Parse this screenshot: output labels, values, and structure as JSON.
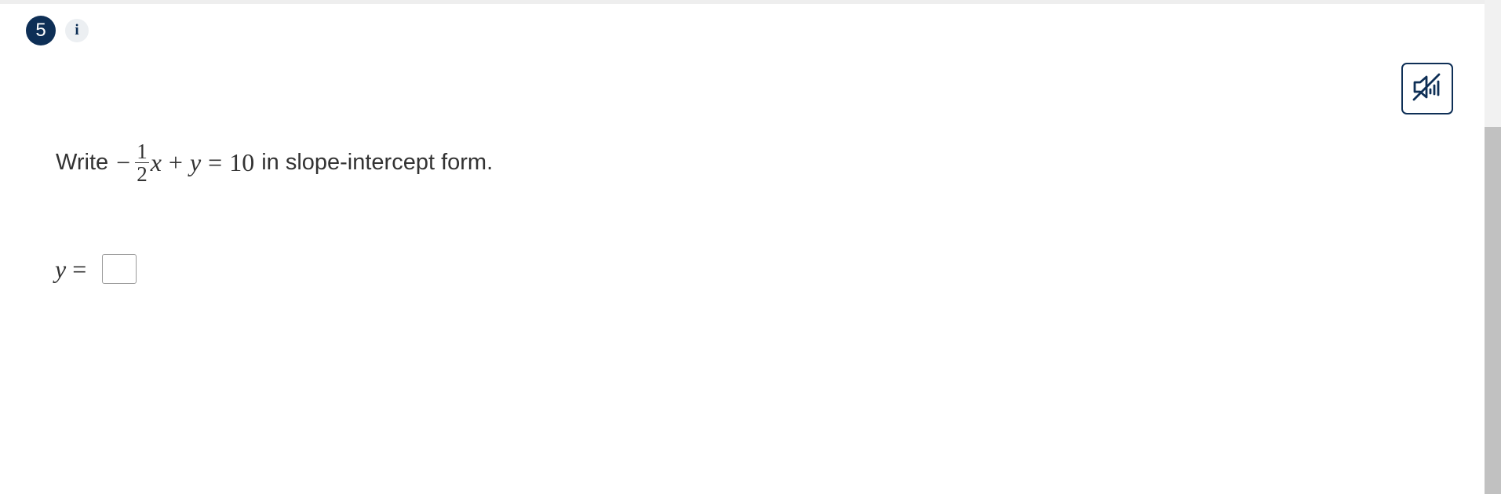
{
  "header": {
    "question_number": "5",
    "info_label": "i"
  },
  "audio": {
    "icon": "speaker-muted-icon",
    "state": "muted"
  },
  "prompt": {
    "prefix": "Write",
    "minus": "−",
    "frac_num": "1",
    "frac_den": "2",
    "x": "x",
    "plus": "+",
    "y": "y",
    "equals": "=",
    "rhs": "10",
    "suffix": "in slope-intercept form."
  },
  "answer": {
    "lhs_var": "y",
    "lhs_equals": "=",
    "value": "",
    "placeholder": ""
  },
  "colors": {
    "accent": "#0e2f56",
    "text": "#333333"
  }
}
